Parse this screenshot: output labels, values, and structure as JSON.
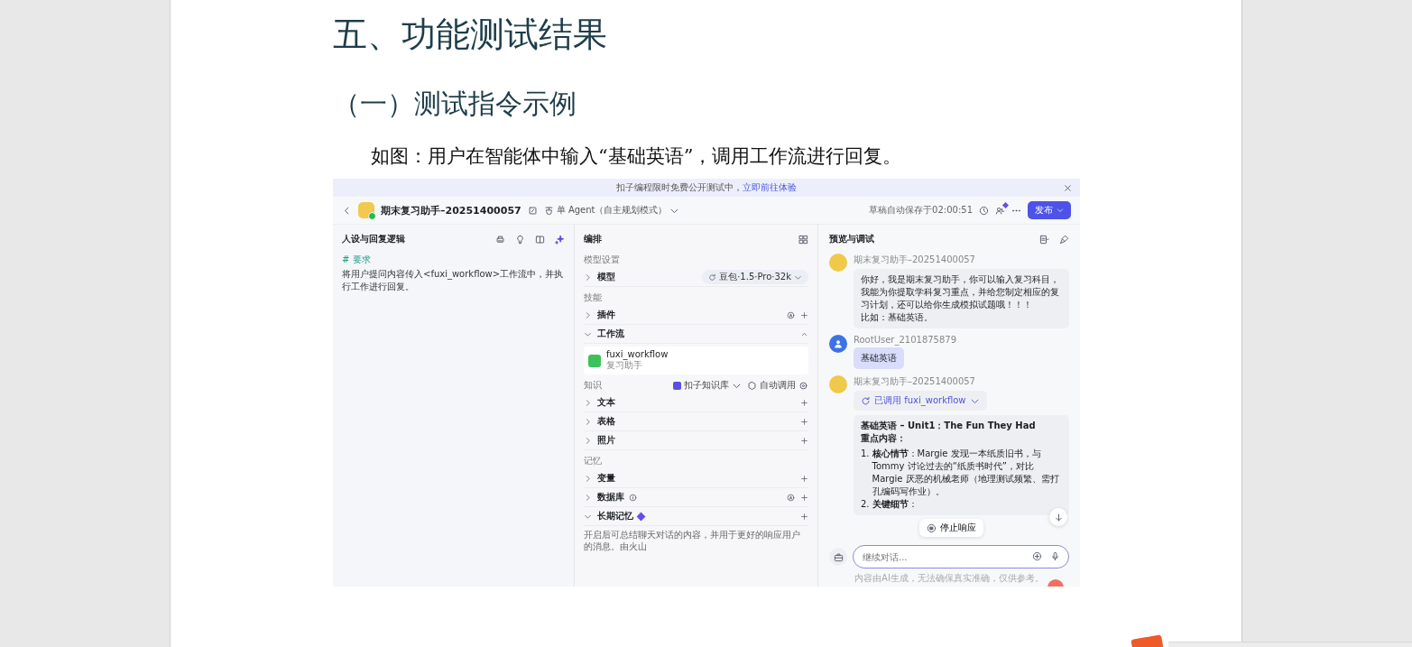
{
  "document": {
    "heading": "五、功能测试结果",
    "subheading": "（一）测试指令示例",
    "caption": "如图：用户在智能体中输入“基础英语”，调用工作流进行回复。"
  },
  "app": {
    "banner": {
      "text": "扣子编程限时免费公开测试中，",
      "link": "立即前往体验"
    },
    "header": {
      "title": "期末复习助手–20251400057",
      "mode": "单 Agent（自主规划模式）",
      "autosave": "草稿自动保存于02:00:51",
      "publish": "发布"
    },
    "left_panel": {
      "title": "人设与回复逻辑",
      "prompt_heading": "# 要求",
      "prompt": "将用户提问内容传入<fuxi_workflow>工作流中，并执行工作进行回复。"
    },
    "middle_panel": {
      "title": "编排",
      "items": [
        {
          "kind": "section",
          "label": "模型设置"
        },
        {
          "kind": "model",
          "label": "模型",
          "expanded": false,
          "model": "豆包·1.5·Pro·32k"
        },
        {
          "kind": "section",
          "label": "技能"
        },
        {
          "kind": "row-auto",
          "label": "插件",
          "expanded": false
        },
        {
          "kind": "row-collapse",
          "label": "工作流",
          "expanded": true
        },
        {
          "kind": "workflow",
          "name": "fuxi_workflow",
          "description": "复习助手"
        },
        {
          "kind": "section-knowledge",
          "label": "知识",
          "source": "扣子知识库",
          "mode": "自动调用"
        },
        {
          "kind": "row",
          "label": "文本",
          "expanded": false
        },
        {
          "kind": "row",
          "label": "表格",
          "expanded": false
        },
        {
          "kind": "row",
          "label": "照片",
          "expanded": false
        },
        {
          "kind": "section",
          "label": "记忆"
        },
        {
          "kind": "row",
          "label": "变量",
          "expanded": false
        },
        {
          "kind": "row-info-auto",
          "label": "数据库",
          "expanded": false
        },
        {
          "kind": "row-badge",
          "label": "长期记忆",
          "expanded": true
        },
        {
          "kind": "description",
          "text": "开启后可总结聊天对话的内容，并用于更好的响应用户的消息。由火山"
        }
      ]
    },
    "right_panel": {
      "title": "预览与调试",
      "messages": [
        {
          "kind": "bot",
          "name": "期末复习助手–20251400057",
          "lines": [
            "你好，我是期末复习助手，你可以输入复习科目，我能为你提取学科复习重点，并给您制定相应的复习计划，还可以给你生成模拟试题哦！！！",
            "比如：基础英语。"
          ]
        },
        {
          "kind": "user",
          "name": "RootUser_2101875879",
          "text": "基础英语"
        },
        {
          "kind": "bot-answer",
          "name": "期末复习助手–20251400057",
          "tool_call": "已调用 fuxi_workflow",
          "title": "基础英语 – Unit1：The Fun They Had",
          "subtitle": "重点内容：",
          "list": [
            {
              "marker": "1.",
              "text": "**核心情节**：Margie 发现一本纸质旧书，与 Tommy 讨论过去的“纸质书时代”，对比 Margie 厌恶的机械老师（地理测试频繁、需打孔编码写作业）。"
            },
            {
              "marker": "2.",
              "text": "**关键细节**："
            }
          ]
        }
      ],
      "stop_button": "停止响应",
      "input_placeholder": "继续对话...",
      "disclaimer": "内容由AI生成，无法确保真实准确，仅供参考。"
    }
  }
}
